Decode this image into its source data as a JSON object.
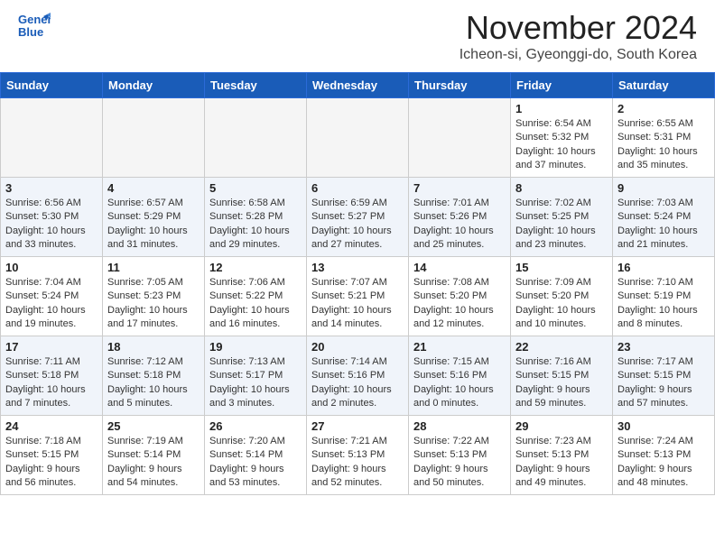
{
  "header": {
    "logo_line1": "General",
    "logo_line2": "Blue",
    "month_title": "November 2024",
    "location": "Icheon-si, Gyeonggi-do, South Korea"
  },
  "weekdays": [
    "Sunday",
    "Monday",
    "Tuesday",
    "Wednesday",
    "Thursday",
    "Friday",
    "Saturday"
  ],
  "weeks": [
    [
      {
        "day": "",
        "info": ""
      },
      {
        "day": "",
        "info": ""
      },
      {
        "day": "",
        "info": ""
      },
      {
        "day": "",
        "info": ""
      },
      {
        "day": "",
        "info": ""
      },
      {
        "day": "1",
        "info": "Sunrise: 6:54 AM\nSunset: 5:32 PM\nDaylight: 10 hours\nand 37 minutes."
      },
      {
        "day": "2",
        "info": "Sunrise: 6:55 AM\nSunset: 5:31 PM\nDaylight: 10 hours\nand 35 minutes."
      }
    ],
    [
      {
        "day": "3",
        "info": "Sunrise: 6:56 AM\nSunset: 5:30 PM\nDaylight: 10 hours\nand 33 minutes."
      },
      {
        "day": "4",
        "info": "Sunrise: 6:57 AM\nSunset: 5:29 PM\nDaylight: 10 hours\nand 31 minutes."
      },
      {
        "day": "5",
        "info": "Sunrise: 6:58 AM\nSunset: 5:28 PM\nDaylight: 10 hours\nand 29 minutes."
      },
      {
        "day": "6",
        "info": "Sunrise: 6:59 AM\nSunset: 5:27 PM\nDaylight: 10 hours\nand 27 minutes."
      },
      {
        "day": "7",
        "info": "Sunrise: 7:01 AM\nSunset: 5:26 PM\nDaylight: 10 hours\nand 25 minutes."
      },
      {
        "day": "8",
        "info": "Sunrise: 7:02 AM\nSunset: 5:25 PM\nDaylight: 10 hours\nand 23 minutes."
      },
      {
        "day": "9",
        "info": "Sunrise: 7:03 AM\nSunset: 5:24 PM\nDaylight: 10 hours\nand 21 minutes."
      }
    ],
    [
      {
        "day": "10",
        "info": "Sunrise: 7:04 AM\nSunset: 5:24 PM\nDaylight: 10 hours\nand 19 minutes."
      },
      {
        "day": "11",
        "info": "Sunrise: 7:05 AM\nSunset: 5:23 PM\nDaylight: 10 hours\nand 17 minutes."
      },
      {
        "day": "12",
        "info": "Sunrise: 7:06 AM\nSunset: 5:22 PM\nDaylight: 10 hours\nand 16 minutes."
      },
      {
        "day": "13",
        "info": "Sunrise: 7:07 AM\nSunset: 5:21 PM\nDaylight: 10 hours\nand 14 minutes."
      },
      {
        "day": "14",
        "info": "Sunrise: 7:08 AM\nSunset: 5:20 PM\nDaylight: 10 hours\nand 12 minutes."
      },
      {
        "day": "15",
        "info": "Sunrise: 7:09 AM\nSunset: 5:20 PM\nDaylight: 10 hours\nand 10 minutes."
      },
      {
        "day": "16",
        "info": "Sunrise: 7:10 AM\nSunset: 5:19 PM\nDaylight: 10 hours\nand 8 minutes."
      }
    ],
    [
      {
        "day": "17",
        "info": "Sunrise: 7:11 AM\nSunset: 5:18 PM\nDaylight: 10 hours\nand 7 minutes."
      },
      {
        "day": "18",
        "info": "Sunrise: 7:12 AM\nSunset: 5:18 PM\nDaylight: 10 hours\nand 5 minutes."
      },
      {
        "day": "19",
        "info": "Sunrise: 7:13 AM\nSunset: 5:17 PM\nDaylight: 10 hours\nand 3 minutes."
      },
      {
        "day": "20",
        "info": "Sunrise: 7:14 AM\nSunset: 5:16 PM\nDaylight: 10 hours\nand 2 minutes."
      },
      {
        "day": "21",
        "info": "Sunrise: 7:15 AM\nSunset: 5:16 PM\nDaylight: 10 hours\nand 0 minutes."
      },
      {
        "day": "22",
        "info": "Sunrise: 7:16 AM\nSunset: 5:15 PM\nDaylight: 9 hours\nand 59 minutes."
      },
      {
        "day": "23",
        "info": "Sunrise: 7:17 AM\nSunset: 5:15 PM\nDaylight: 9 hours\nand 57 minutes."
      }
    ],
    [
      {
        "day": "24",
        "info": "Sunrise: 7:18 AM\nSunset: 5:15 PM\nDaylight: 9 hours\nand 56 minutes."
      },
      {
        "day": "25",
        "info": "Sunrise: 7:19 AM\nSunset: 5:14 PM\nDaylight: 9 hours\nand 54 minutes."
      },
      {
        "day": "26",
        "info": "Sunrise: 7:20 AM\nSunset: 5:14 PM\nDaylight: 9 hours\nand 53 minutes."
      },
      {
        "day": "27",
        "info": "Sunrise: 7:21 AM\nSunset: 5:13 PM\nDaylight: 9 hours\nand 52 minutes."
      },
      {
        "day": "28",
        "info": "Sunrise: 7:22 AM\nSunset: 5:13 PM\nDaylight: 9 hours\nand 50 minutes."
      },
      {
        "day": "29",
        "info": "Sunrise: 7:23 AM\nSunset: 5:13 PM\nDaylight: 9 hours\nand 49 minutes."
      },
      {
        "day": "30",
        "info": "Sunrise: 7:24 AM\nSunset: 5:13 PM\nDaylight: 9 hours\nand 48 minutes."
      }
    ]
  ]
}
